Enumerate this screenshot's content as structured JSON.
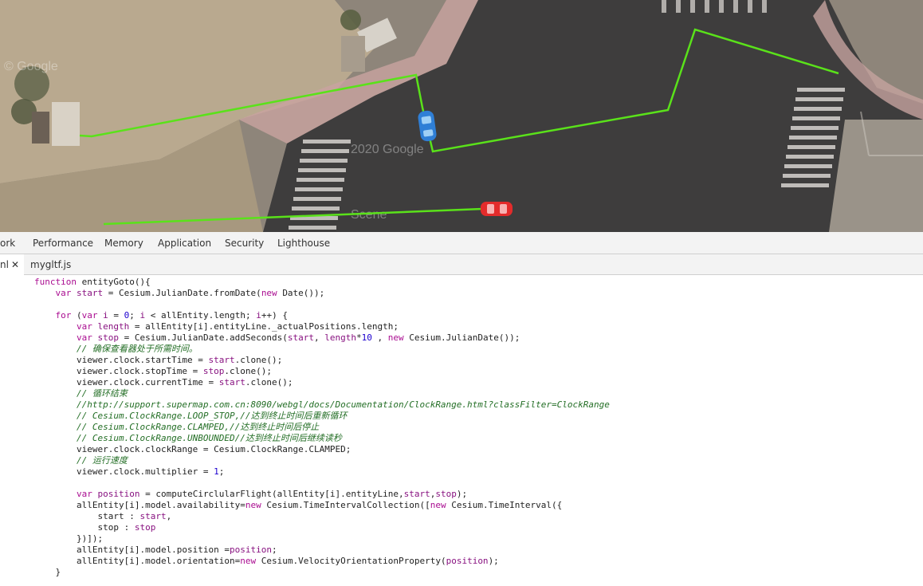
{
  "devtools_tabs": [
    "ork",
    "Performance",
    "Memory",
    "Application",
    "Security",
    "Lighthouse"
  ],
  "file_tabs": {
    "active": "nl",
    "active_close": "✕",
    "second": "mygltf.js"
  },
  "map": {
    "watermark_1": "© Google",
    "watermark_2": "2020 Google",
    "watermark_3": "Scene",
    "route_color": "#5ae21a",
    "car_blue_color": "#2f7fd6",
    "car_red_color": "#e32b2b"
  },
  "code": {
    "lines": [
      [
        {
          "t": "function ",
          "c": "kw"
        },
        {
          "t": "entityGoto(){",
          "c": "plain"
        }
      ],
      [
        {
          "t": "    ",
          "c": "plain"
        },
        {
          "t": "var ",
          "c": "kw"
        },
        {
          "t": "start",
          "c": "var"
        },
        {
          "t": " = Cesium.JulianDate.fromDate(",
          "c": "plain"
        },
        {
          "t": "new ",
          "c": "kw"
        },
        {
          "t": "Date());",
          "c": "plain"
        }
      ],
      [],
      [
        {
          "t": "    ",
          "c": "plain"
        },
        {
          "t": "for ",
          "c": "kw"
        },
        {
          "t": "(",
          "c": "plain"
        },
        {
          "t": "var ",
          "c": "kw"
        },
        {
          "t": "i",
          "c": "var"
        },
        {
          "t": " = ",
          "c": "plain"
        },
        {
          "t": "0",
          "c": "num"
        },
        {
          "t": "; ",
          "c": "plain"
        },
        {
          "t": "i",
          "c": "var"
        },
        {
          "t": " < allEntity.length; ",
          "c": "plain"
        },
        {
          "t": "i",
          "c": "var"
        },
        {
          "t": "++) {",
          "c": "plain"
        }
      ],
      [
        {
          "t": "        ",
          "c": "plain"
        },
        {
          "t": "var ",
          "c": "kw"
        },
        {
          "t": "length",
          "c": "var"
        },
        {
          "t": " = allEntity[i].entityLine._actualPositions.length;",
          "c": "plain"
        }
      ],
      [
        {
          "t": "        ",
          "c": "plain"
        },
        {
          "t": "var ",
          "c": "kw"
        },
        {
          "t": "stop",
          "c": "var"
        },
        {
          "t": " = Cesium.JulianDate.addSeconds(",
          "c": "plain"
        },
        {
          "t": "start",
          "c": "var"
        },
        {
          "t": ", ",
          "c": "plain"
        },
        {
          "t": "length",
          "c": "var"
        },
        {
          "t": "*",
          "c": "plain"
        },
        {
          "t": "10",
          "c": "num"
        },
        {
          "t": " , ",
          "c": "plain"
        },
        {
          "t": "new ",
          "c": "kw"
        },
        {
          "t": "Cesium.JulianDate());",
          "c": "plain"
        }
      ],
      [
        {
          "t": "        // 确保查看器处于所需时间。",
          "c": "comment"
        }
      ],
      [
        {
          "t": "        viewer.clock.startTime = ",
          "c": "plain"
        },
        {
          "t": "start",
          "c": "var"
        },
        {
          "t": ".clone();",
          "c": "plain"
        }
      ],
      [
        {
          "t": "        viewer.clock.stopTime = ",
          "c": "plain"
        },
        {
          "t": "stop",
          "c": "var"
        },
        {
          "t": ".clone();",
          "c": "plain"
        }
      ],
      [
        {
          "t": "        viewer.clock.currentTime = ",
          "c": "plain"
        },
        {
          "t": "start",
          "c": "var"
        },
        {
          "t": ".clone();",
          "c": "plain"
        }
      ],
      [
        {
          "t": "        // 循环结束",
          "c": "comment"
        }
      ],
      [
        {
          "t": "        //http://support.supermap.com.cn:8090/webgl/docs/Documentation/ClockRange.html?classFilter=ClockRange",
          "c": "comment"
        }
      ],
      [
        {
          "t": "        // Cesium.ClockRange.LOOP_STOP,//达到终止时间后重新循环",
          "c": "comment"
        }
      ],
      [
        {
          "t": "        // Cesium.ClockRange.CLAMPED,//达到终止时间后停止",
          "c": "comment"
        }
      ],
      [
        {
          "t": "        // Cesium.ClockRange.UNBOUNDED//达到终止时间后继续读秒",
          "c": "comment"
        }
      ],
      [
        {
          "t": "        viewer.clock.clockRange = Cesium.ClockRange.CLAMPED;",
          "c": "plain"
        }
      ],
      [
        {
          "t": "        // 运行速度",
          "c": "comment"
        }
      ],
      [
        {
          "t": "        viewer.clock.multiplier = ",
          "c": "plain"
        },
        {
          "t": "1",
          "c": "num"
        },
        {
          "t": ";",
          "c": "plain"
        }
      ],
      [],
      [
        {
          "t": "        ",
          "c": "plain"
        },
        {
          "t": "var ",
          "c": "kw"
        },
        {
          "t": "position",
          "c": "var"
        },
        {
          "t": " = computeCirclularFlight(allEntity[i].entityLine,",
          "c": "plain"
        },
        {
          "t": "start",
          "c": "var"
        },
        {
          "t": ",",
          "c": "plain"
        },
        {
          "t": "stop",
          "c": "var"
        },
        {
          "t": ");",
          "c": "plain"
        }
      ],
      [
        {
          "t": "        allEntity[i].model.availability=",
          "c": "plain"
        },
        {
          "t": "new ",
          "c": "kw"
        },
        {
          "t": "Cesium.TimeIntervalCollection([",
          "c": "plain"
        },
        {
          "t": "new ",
          "c": "kw"
        },
        {
          "t": "Cesium.TimeInterval({",
          "c": "plain"
        }
      ],
      [
        {
          "t": "            start : ",
          "c": "plain"
        },
        {
          "t": "start",
          "c": "var"
        },
        {
          "t": ",",
          "c": "plain"
        }
      ],
      [
        {
          "t": "            stop : ",
          "c": "plain"
        },
        {
          "t": "stop",
          "c": "var"
        }
      ],
      [
        {
          "t": "        })]);",
          "c": "plain"
        }
      ],
      [
        {
          "t": "        allEntity[i].model.position =",
          "c": "plain"
        },
        {
          "t": "position",
          "c": "var"
        },
        {
          "t": ";",
          "c": "plain"
        }
      ],
      [
        {
          "t": "        allEntity[i].model.orientation=",
          "c": "plain"
        },
        {
          "t": "new ",
          "c": "kw"
        },
        {
          "t": "Cesium.VelocityOrientationProperty(",
          "c": "plain"
        },
        {
          "t": "position",
          "c": "var"
        },
        {
          "t": ");",
          "c": "plain"
        }
      ],
      [
        {
          "t": "    }",
          "c": "plain"
        }
      ]
    ]
  }
}
